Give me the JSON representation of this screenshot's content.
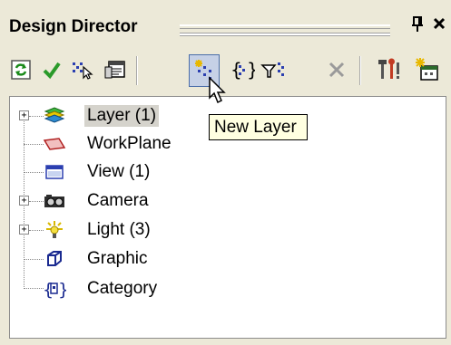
{
  "panel": {
    "title": "Design Director",
    "pin_glyph": "ф",
    "close_glyph": "×"
  },
  "toolbar": [
    {
      "name": "refresh-icon",
      "hint": ""
    },
    {
      "name": "checkmark-icon",
      "hint": ""
    },
    {
      "name": "select-objects-icon",
      "hint": ""
    },
    {
      "name": "properties-icon",
      "hint": ""
    },
    {
      "name": "new-layer-icon",
      "hint": "New Layer",
      "pressed": true
    },
    {
      "name": "new-category-icon",
      "hint": ""
    },
    {
      "name": "filter-icon",
      "hint": ""
    },
    {
      "name": "delete-icon",
      "hint": ""
    },
    {
      "name": "tools-icon",
      "hint": ""
    },
    {
      "name": "new-item-icon",
      "hint": ""
    }
  ],
  "tooltip": {
    "text": "New Layer"
  },
  "tree": {
    "items": [
      {
        "label": "Layer (1)",
        "icon": "layers-icon",
        "expandable": true,
        "selected": true
      },
      {
        "label": "WorkPlane",
        "icon": "workplane-icon",
        "expandable": false,
        "selected": false
      },
      {
        "label": "View (1)",
        "icon": "view-icon",
        "expandable": false,
        "selected": false
      },
      {
        "label": "Camera",
        "icon": "camera-icon",
        "expandable": true,
        "selected": false
      },
      {
        "label": "Light (3)",
        "icon": "light-icon",
        "expandable": true,
        "selected": false
      },
      {
        "label": "Graphic",
        "icon": "graphic-icon",
        "expandable": false,
        "selected": false
      },
      {
        "label": "Category",
        "icon": "category-icon",
        "expandable": false,
        "selected": false
      }
    ]
  },
  "expander_glyph": "+"
}
